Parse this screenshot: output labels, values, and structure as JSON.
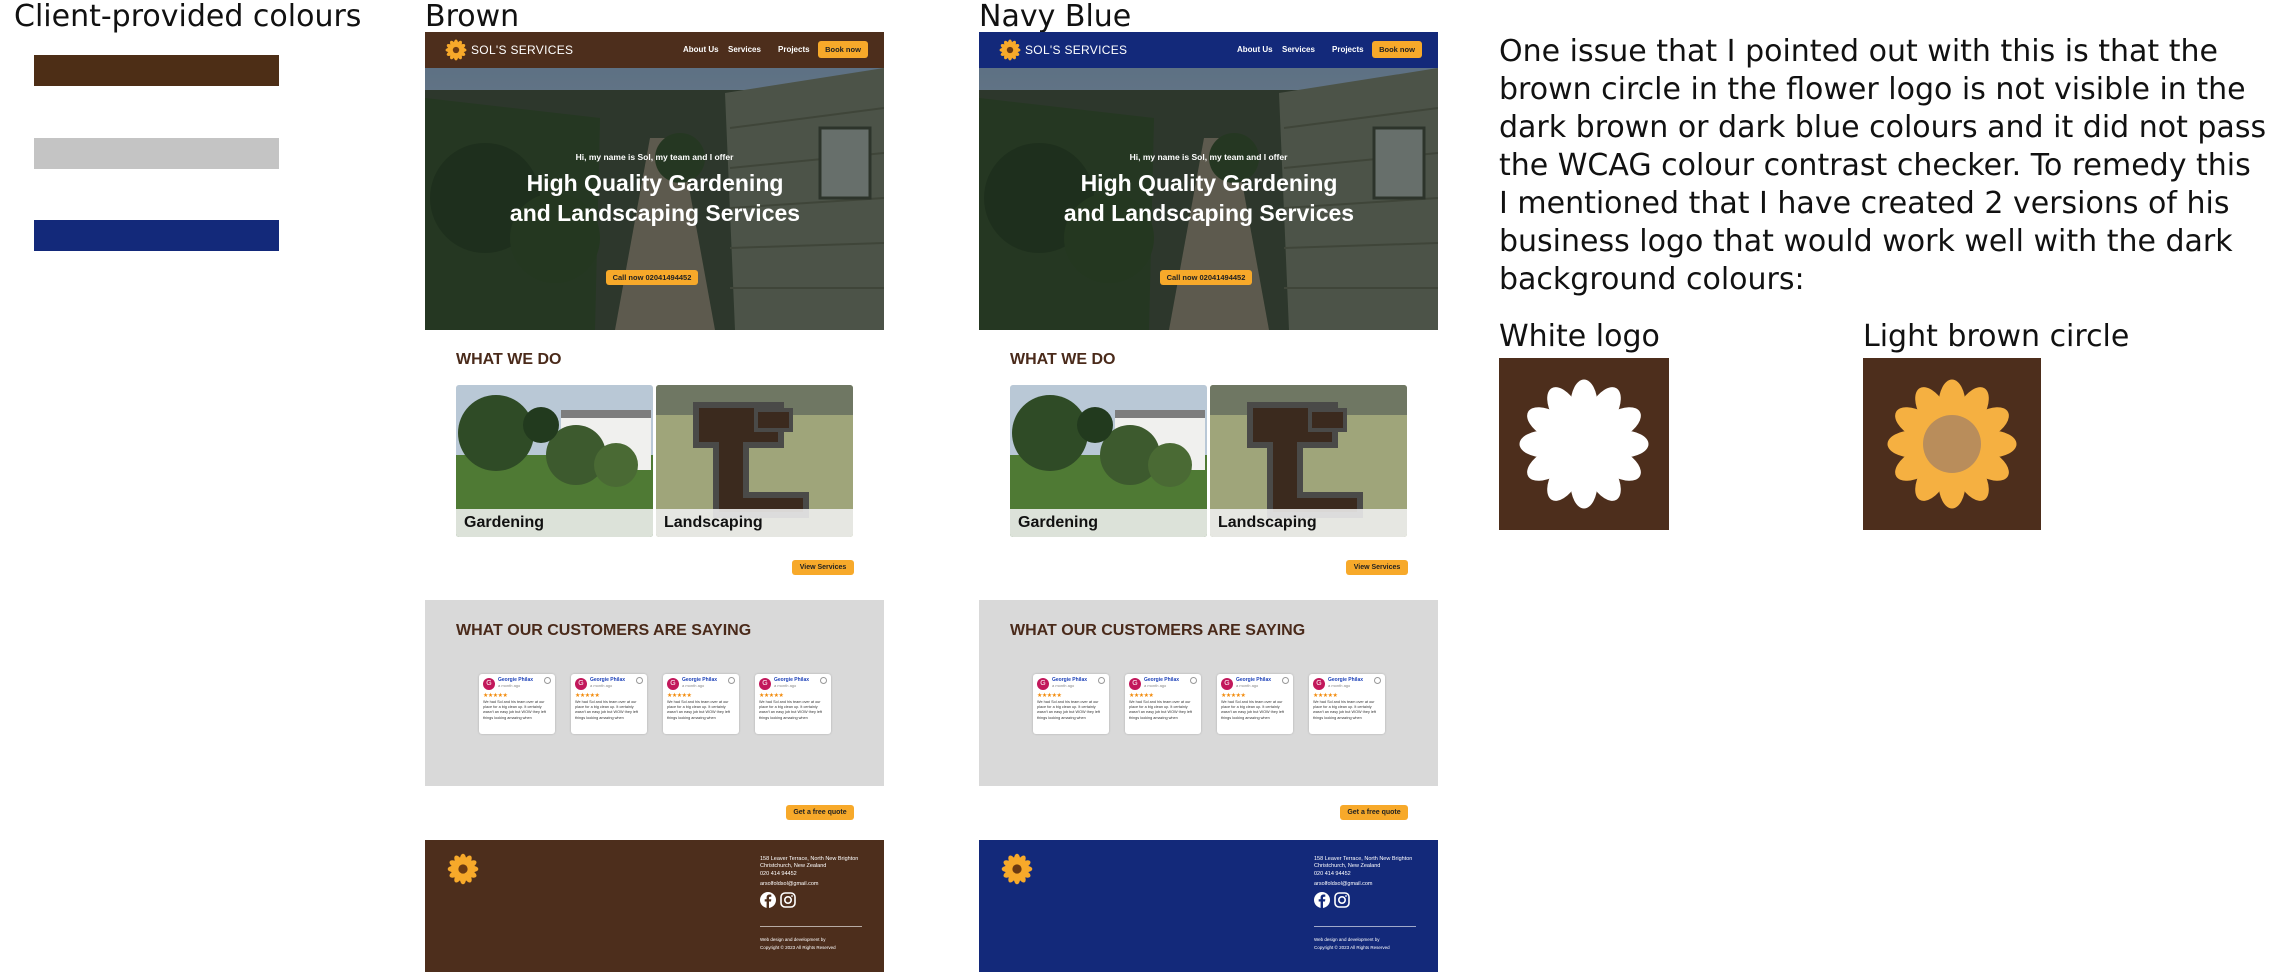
{
  "palette": {
    "title": "Client-provided colours",
    "swatches": [
      "#4d2e16",
      "#c4c4c4",
      "#13297a"
    ]
  },
  "variants": [
    {
      "name": "Brown",
      "nav_color": "#4d2e1c",
      "footer_color": "#4d2e1c"
    },
    {
      "name": "Navy Blue",
      "nav_color": "#13297a",
      "footer_color": "#13297a"
    }
  ],
  "site": {
    "brand": "SOL'S SERVICES",
    "nav_links": [
      "About Us",
      "Services",
      "Projects"
    ],
    "book_button": "Book now",
    "hero_intro": "Hi, my name is Sol, my team and I offer",
    "hero_headline": "High Quality Gardening and Landscaping Services",
    "call_button": "Call now 02041494452",
    "what_we_do": "WHAT WE DO",
    "services": [
      "Gardening",
      "Landscaping"
    ],
    "view_services": "View Services",
    "customers_title": "WHAT OUR CUSTOMERS ARE SAYING",
    "reviews": [
      {
        "initial": "G",
        "name": "Georgie Philax",
        "time": "a month ago",
        "stars": "★★★★★",
        "text": "We had Sol and his team over at our place for a big clean up. It certainly wasn't an easy job but WOW they left things looking amazing when"
      },
      {
        "initial": "G",
        "name": "Georgie Philax",
        "time": "a month ago",
        "stars": "★★★★★",
        "text": "We had Sol and his team over at our place for a big clean up. It certainly wasn't an easy job but WOW they left things looking amazing when"
      },
      {
        "initial": "G",
        "name": "Georgie Philax",
        "time": "a month ago",
        "stars": "★★★★★",
        "text": "We had Sol and his team over at our place for a big clean up. It certainly wasn't an easy job but WOW they left things looking amazing when"
      },
      {
        "initial": "G",
        "name": "Georgie Philax",
        "time": "a month ago",
        "stars": "★★★★★",
        "text": "We had Sol and his team over at our place for a big clean up. It certainly wasn't an easy job but WOW they left things looking amazing when"
      }
    ],
    "quote_button": "Get a free quote",
    "footer_address": "158 Leaver Terrace, North New Brighton Christchurch, New Zealand",
    "footer_phone": "020 414 94452",
    "footer_email": "arsolfoldsol@gmail.com",
    "footer_credit": "Web design and development by",
    "footer_copyright": "Copyright © 2023 All Rights Reserved"
  },
  "note": {
    "text": "One issue that I pointed out with this is that the brown circle in the flower logo is not visible in the dark brown or dark blue colours and it did not pass the WCAG colour contrast checker. To remedy this I mentioned that I have created 2 versions of his business logo that would work well with the dark background colours:",
    "logo_variants": [
      "White logo",
      "Light brown circle"
    ]
  },
  "icons": [
    "sunflower-logo-icon",
    "facebook-icon",
    "instagram-icon",
    "google-icon"
  ],
  "accent_color": "#f7a92a"
}
